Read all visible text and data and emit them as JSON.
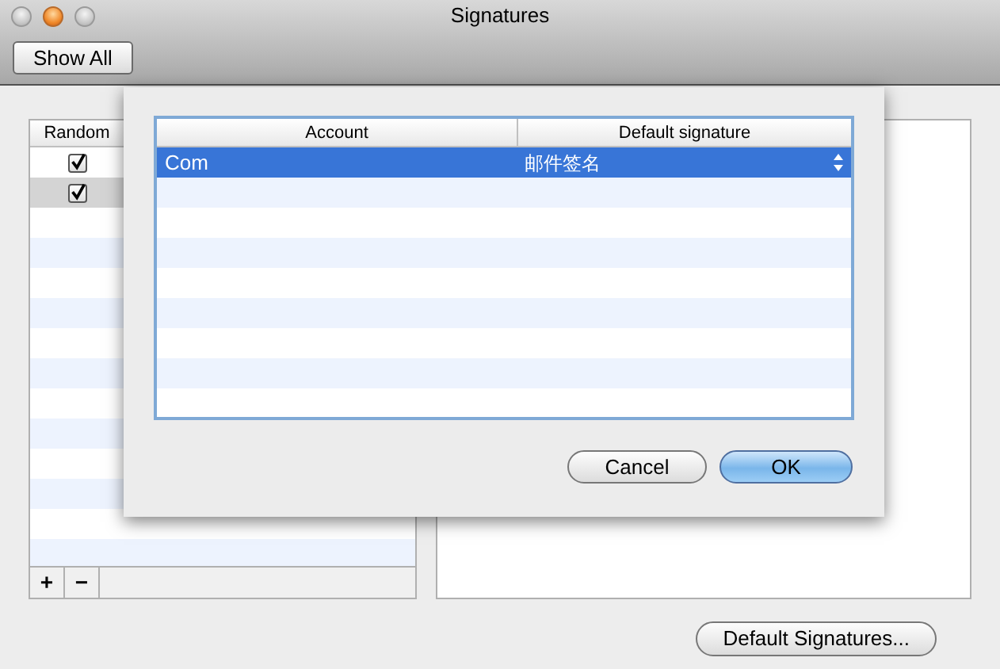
{
  "window": {
    "title": "Signatures"
  },
  "toolbar": {
    "buttons": [
      "Show All"
    ]
  },
  "signatures_table": {
    "columns": [
      "Random"
    ],
    "rows": [
      {
        "checked": true,
        "selected": false
      },
      {
        "checked": true,
        "selected": true
      }
    ],
    "buttons": [
      "+",
      "−"
    ]
  },
  "default_button": "Default Signatures...",
  "sheet": {
    "columns": [
      "Account",
      "Default signature"
    ],
    "rows": [
      {
        "account": "Com",
        "signature": "邮件签名",
        "selected": true
      }
    ],
    "buttons": [
      {
        "label": "Cancel",
        "kind": "normal"
      },
      {
        "label": "OK",
        "kind": "default"
      }
    ]
  }
}
